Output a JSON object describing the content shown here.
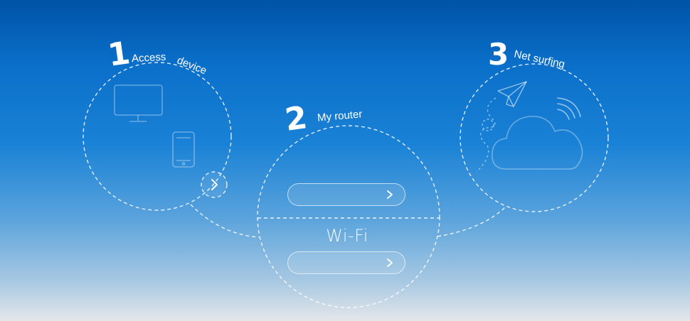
{
  "steps": {
    "step1": {
      "number": "1",
      "label_part1": "Access",
      "label_part2": "device"
    },
    "step2": {
      "number": "2",
      "label": "My router"
    },
    "step3": {
      "number": "3",
      "label": "Net surfing"
    }
  },
  "router": {
    "wifi_label": "Wi-Fi"
  },
  "icons": {
    "monitor": "monitor-icon",
    "phone": "smartphone-icon",
    "next": "chevron-right-icon",
    "plane": "paper-plane-icon",
    "cloud": "cloud-icon",
    "signal": "signal-waves-icon"
  },
  "colors": {
    "line": "#ffffff"
  }
}
